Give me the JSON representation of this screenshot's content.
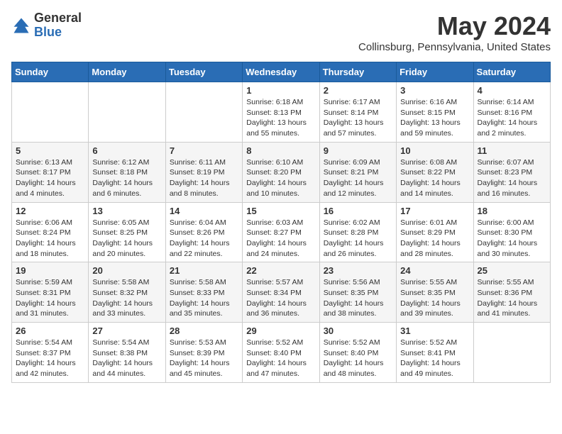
{
  "logo": {
    "general": "General",
    "blue": "Blue"
  },
  "header": {
    "month": "May 2024",
    "location": "Collinsburg, Pennsylvania, United States"
  },
  "weekdays": [
    "Sunday",
    "Monday",
    "Tuesday",
    "Wednesday",
    "Thursday",
    "Friday",
    "Saturday"
  ],
  "weeks": [
    [
      {
        "day": "",
        "info": ""
      },
      {
        "day": "",
        "info": ""
      },
      {
        "day": "",
        "info": ""
      },
      {
        "day": "1",
        "info": "Sunrise: 6:18 AM\nSunset: 8:13 PM\nDaylight: 13 hours and 55 minutes."
      },
      {
        "day": "2",
        "info": "Sunrise: 6:17 AM\nSunset: 8:14 PM\nDaylight: 13 hours and 57 minutes."
      },
      {
        "day": "3",
        "info": "Sunrise: 6:16 AM\nSunset: 8:15 PM\nDaylight: 13 hours and 59 minutes."
      },
      {
        "day": "4",
        "info": "Sunrise: 6:14 AM\nSunset: 8:16 PM\nDaylight: 14 hours and 2 minutes."
      }
    ],
    [
      {
        "day": "5",
        "info": "Sunrise: 6:13 AM\nSunset: 8:17 PM\nDaylight: 14 hours and 4 minutes."
      },
      {
        "day": "6",
        "info": "Sunrise: 6:12 AM\nSunset: 8:18 PM\nDaylight: 14 hours and 6 minutes."
      },
      {
        "day": "7",
        "info": "Sunrise: 6:11 AM\nSunset: 8:19 PM\nDaylight: 14 hours and 8 minutes."
      },
      {
        "day": "8",
        "info": "Sunrise: 6:10 AM\nSunset: 8:20 PM\nDaylight: 14 hours and 10 minutes."
      },
      {
        "day": "9",
        "info": "Sunrise: 6:09 AM\nSunset: 8:21 PM\nDaylight: 14 hours and 12 minutes."
      },
      {
        "day": "10",
        "info": "Sunrise: 6:08 AM\nSunset: 8:22 PM\nDaylight: 14 hours and 14 minutes."
      },
      {
        "day": "11",
        "info": "Sunrise: 6:07 AM\nSunset: 8:23 PM\nDaylight: 14 hours and 16 minutes."
      }
    ],
    [
      {
        "day": "12",
        "info": "Sunrise: 6:06 AM\nSunset: 8:24 PM\nDaylight: 14 hours and 18 minutes."
      },
      {
        "day": "13",
        "info": "Sunrise: 6:05 AM\nSunset: 8:25 PM\nDaylight: 14 hours and 20 minutes."
      },
      {
        "day": "14",
        "info": "Sunrise: 6:04 AM\nSunset: 8:26 PM\nDaylight: 14 hours and 22 minutes."
      },
      {
        "day": "15",
        "info": "Sunrise: 6:03 AM\nSunset: 8:27 PM\nDaylight: 14 hours and 24 minutes."
      },
      {
        "day": "16",
        "info": "Sunrise: 6:02 AM\nSunset: 8:28 PM\nDaylight: 14 hours and 26 minutes."
      },
      {
        "day": "17",
        "info": "Sunrise: 6:01 AM\nSunset: 8:29 PM\nDaylight: 14 hours and 28 minutes."
      },
      {
        "day": "18",
        "info": "Sunrise: 6:00 AM\nSunset: 8:30 PM\nDaylight: 14 hours and 30 minutes."
      }
    ],
    [
      {
        "day": "19",
        "info": "Sunrise: 5:59 AM\nSunset: 8:31 PM\nDaylight: 14 hours and 31 minutes."
      },
      {
        "day": "20",
        "info": "Sunrise: 5:58 AM\nSunset: 8:32 PM\nDaylight: 14 hours and 33 minutes."
      },
      {
        "day": "21",
        "info": "Sunrise: 5:58 AM\nSunset: 8:33 PM\nDaylight: 14 hours and 35 minutes."
      },
      {
        "day": "22",
        "info": "Sunrise: 5:57 AM\nSunset: 8:34 PM\nDaylight: 14 hours and 36 minutes."
      },
      {
        "day": "23",
        "info": "Sunrise: 5:56 AM\nSunset: 8:35 PM\nDaylight: 14 hours and 38 minutes."
      },
      {
        "day": "24",
        "info": "Sunrise: 5:55 AM\nSunset: 8:35 PM\nDaylight: 14 hours and 39 minutes."
      },
      {
        "day": "25",
        "info": "Sunrise: 5:55 AM\nSunset: 8:36 PM\nDaylight: 14 hours and 41 minutes."
      }
    ],
    [
      {
        "day": "26",
        "info": "Sunrise: 5:54 AM\nSunset: 8:37 PM\nDaylight: 14 hours and 42 minutes."
      },
      {
        "day": "27",
        "info": "Sunrise: 5:54 AM\nSunset: 8:38 PM\nDaylight: 14 hours and 44 minutes."
      },
      {
        "day": "28",
        "info": "Sunrise: 5:53 AM\nSunset: 8:39 PM\nDaylight: 14 hours and 45 minutes."
      },
      {
        "day": "29",
        "info": "Sunrise: 5:52 AM\nSunset: 8:40 PM\nDaylight: 14 hours and 47 minutes."
      },
      {
        "day": "30",
        "info": "Sunrise: 5:52 AM\nSunset: 8:40 PM\nDaylight: 14 hours and 48 minutes."
      },
      {
        "day": "31",
        "info": "Sunrise: 5:52 AM\nSunset: 8:41 PM\nDaylight: 14 hours and 49 minutes."
      },
      {
        "day": "",
        "info": ""
      }
    ]
  ]
}
